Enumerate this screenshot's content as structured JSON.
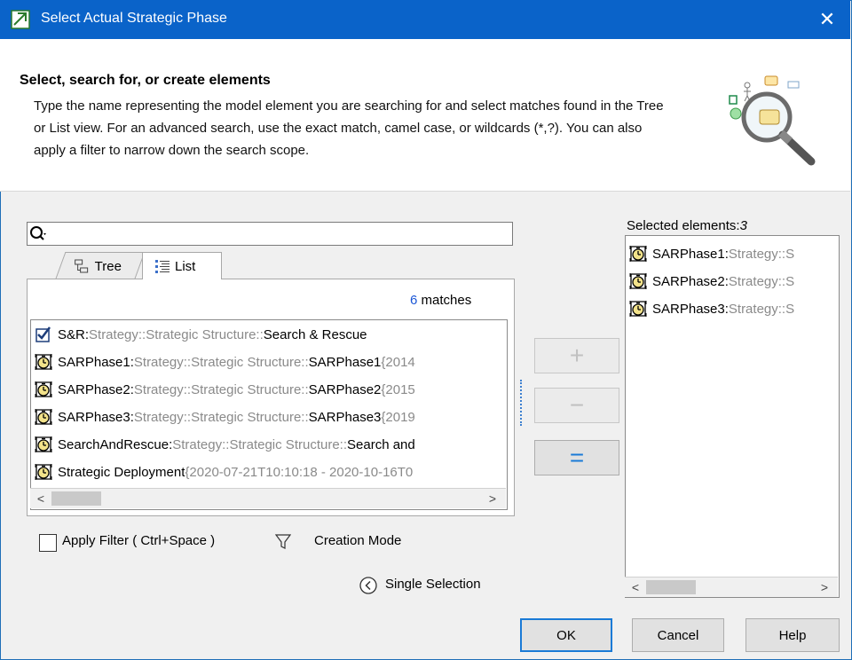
{
  "window": {
    "title": "Select Actual Strategic Phase"
  },
  "header": {
    "title": "Select, search for, or create elements",
    "description": "Type the name representing the model element you are searching for and select matches found in the Tree or List view. For an advanced search, use the exact match, camel case, or wildcards (*,?). You can also apply a filter to narrow down the search scope."
  },
  "search": {
    "value": ""
  },
  "tabs": [
    {
      "label": "Tree",
      "icon": "tree-icon",
      "selected": false
    },
    {
      "label": "List",
      "icon": "list-icon",
      "selected": true
    }
  ],
  "results": {
    "count": "6",
    "count_suffix": " matches",
    "items": [
      {
        "name": "S&R",
        "sep": " : ",
        "qualifier": "Strategy::Strategic Structure::",
        "element": "Search & Rescue",
        "extra": "",
        "icon": "checked-strategy-icon"
      },
      {
        "name": "SARPhase1",
        "sep": " : ",
        "qualifier": "Strategy::Strategic Structure::",
        "element": "SARPhase1",
        "extra": " {2014",
        "icon": "timer-icon"
      },
      {
        "name": "SARPhase2",
        "sep": " : ",
        "qualifier": "Strategy::Strategic Structure::",
        "element": "SARPhase2",
        "extra": " {2015",
        "icon": "timer-icon"
      },
      {
        "name": "SARPhase3",
        "sep": " : ",
        "qualifier": "Strategy::Strategic Structure::",
        "element": "SARPhase3",
        "extra": " {2019",
        "icon": "timer-icon"
      },
      {
        "name": "SearchAndRescue",
        "sep": " : ",
        "qualifier": "Strategy::Strategic Structure::",
        "element": "Search and",
        "extra": "",
        "icon": "timer-icon"
      },
      {
        "name": "Strategic Deployment",
        "sep": "",
        "qualifier": "",
        "element": "",
        "extra": " {2020-07-21T10:10:18 - 2020-10-16T0",
        "icon": "timer-icon"
      }
    ]
  },
  "controls": {
    "apply_filter_label": "Apply Filter ( Ctrl+Space )",
    "apply_filter_checked": false,
    "creation_mode_label": "Creation Mode",
    "single_selection_label": "Single Selection",
    "add_symbol": "+",
    "remove_symbol": "−",
    "set_symbol": "="
  },
  "selected": {
    "label": "Selected elements:",
    "count": "3",
    "items": [
      {
        "name": "SARPhase1",
        "sep": " : ",
        "qualifier": "Strategy::S",
        "icon": "timer-icon"
      },
      {
        "name": "SARPhase2",
        "sep": " : ",
        "qualifier": "Strategy::S",
        "icon": "timer-icon"
      },
      {
        "name": "SARPhase3",
        "sep": " : ",
        "qualifier": "Strategy::S",
        "icon": "timer-icon"
      }
    ]
  },
  "buttons": {
    "ok": "OK",
    "cancel": "Cancel",
    "help": "Help"
  },
  "colors": {
    "titlebar": "#0a63c9",
    "accent": "#1a7ad6",
    "qualifier": "#8a8a8a",
    "match_count": "#1a56d6"
  }
}
